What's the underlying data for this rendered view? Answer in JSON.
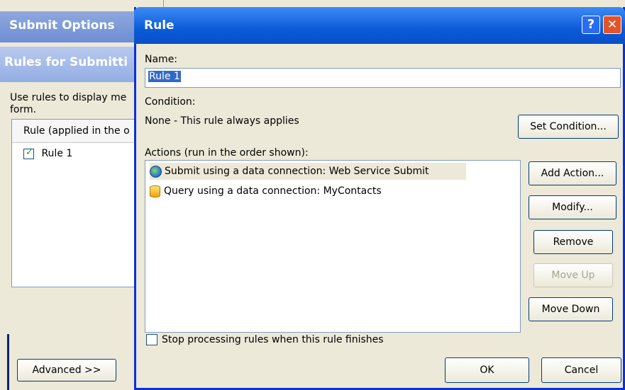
{
  "background_dialog": {
    "title": "Submit Options",
    "header": "Rules for Submitti",
    "description": "Use rules to display me form.",
    "list_header": "Rule (applied in the o",
    "rule_item": "Rule 1",
    "rule_checked": true,
    "advanced_button": "Advanced >>"
  },
  "rule_dialog": {
    "title": "Rule",
    "help_glyph": "?",
    "close_glyph": "✕",
    "name_label": "Name:",
    "name_value": "Rule 1",
    "condition_label": "Condition:",
    "condition_text": "None - This rule always applies",
    "set_condition_button": "Set Condition...",
    "actions_label": "Actions (run in the order shown):",
    "actions": [
      {
        "icon": "web-service-icon",
        "label": "Submit using a data connection: Web Service Submit",
        "selected": true
      },
      {
        "icon": "database-icon",
        "label": "Query using a data connection: MyContacts",
        "selected": false
      }
    ],
    "add_action_button": "Add Action...",
    "modify_button": "Modify...",
    "remove_button": "Remove",
    "move_up_button": "Move Up",
    "move_up_enabled": false,
    "move_down_button": "Move Down",
    "stop_processing_label": "Stop processing rules when this rule finishes",
    "stop_processing_checked": false,
    "ok_button": "OK",
    "cancel_button": "Cancel"
  },
  "colors": {
    "titlebar_blue": "#0b5bd8",
    "dialog_face": "#ece9d8",
    "selection_blue": "#316ac5"
  }
}
